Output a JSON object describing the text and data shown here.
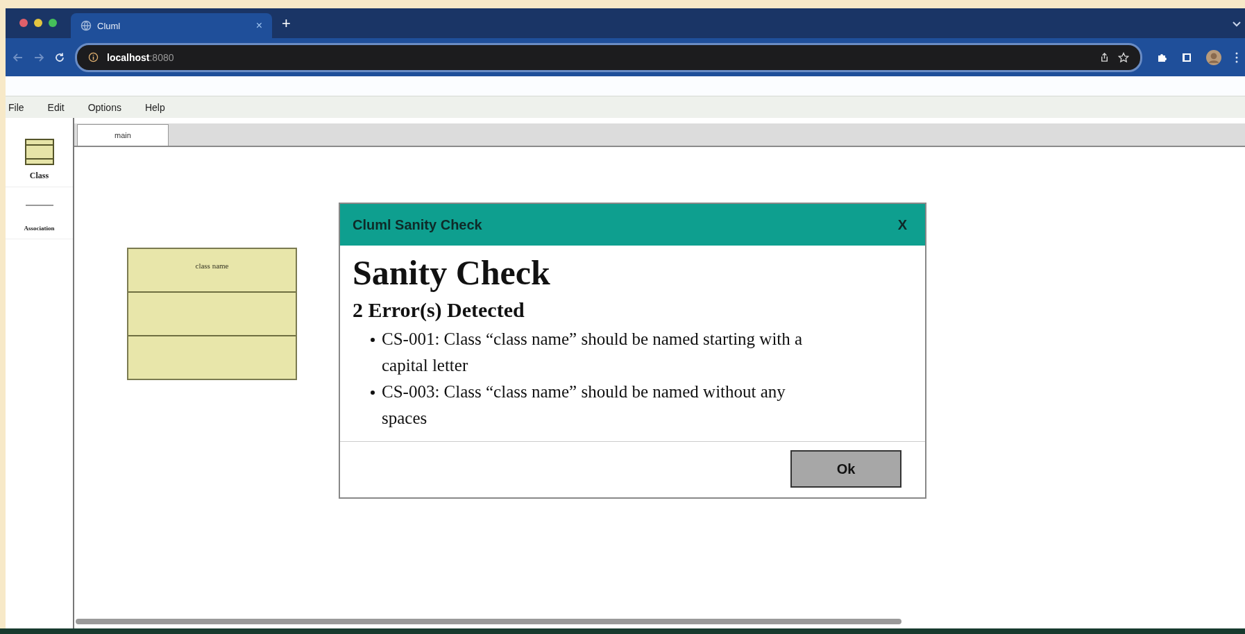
{
  "browser": {
    "tabs": [
      {
        "title": "Cluml",
        "close": "×",
        "selected": true
      }
    ],
    "new_tab": "+",
    "address": {
      "host": "localhost",
      "port": ":8080"
    }
  },
  "menu": [
    "File",
    "Edit",
    "Options",
    "Help"
  ],
  "palette": [
    {
      "label": "Class",
      "kind": "class"
    },
    {
      "label": "Association",
      "kind": "association"
    }
  ],
  "diagram_tabs": [
    {
      "label": "main",
      "selected": true
    }
  ],
  "canvas": {
    "classes": [
      {
        "name": "class name"
      }
    ]
  },
  "dialog": {
    "title": "Cluml Sanity Check",
    "close": "X",
    "heading": "Sanity Check",
    "subheading": "2 Error(s) Detected",
    "errors": [
      "CS-001: Class “class name” should be named starting with a capital letter",
      "CS-003: Class “class name” should be named without any spaces"
    ],
    "buttons": [
      "Ok"
    ]
  }
}
